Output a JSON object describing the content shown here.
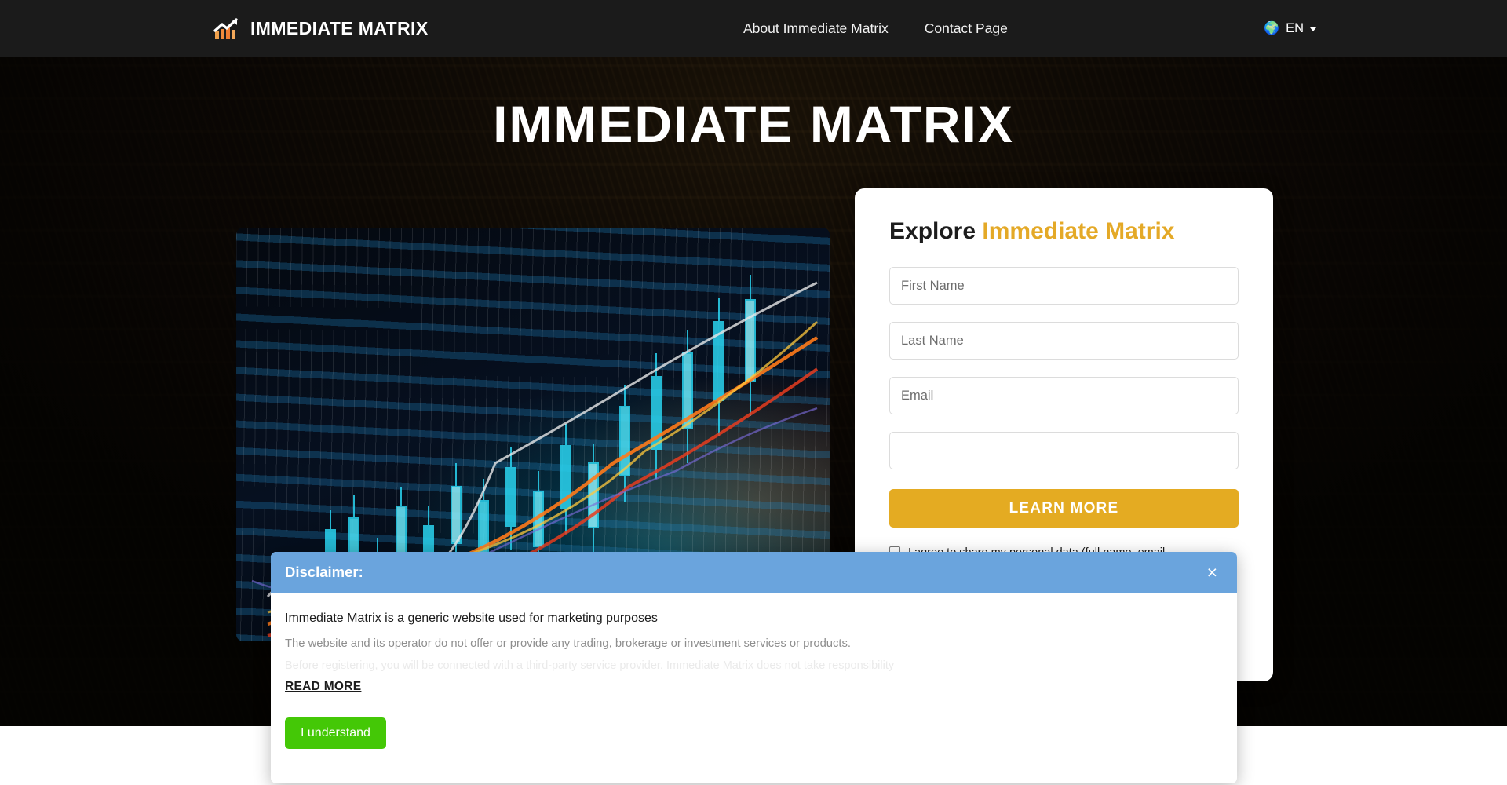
{
  "navbar": {
    "brand_name": "IMMEDIATE MATRIX",
    "brand_icon": "chart-growth-icon",
    "links": [
      {
        "label": "About Immediate Matrix"
      },
      {
        "label": "Contact Page"
      }
    ],
    "language": {
      "icon": "globe-icon",
      "glyph": "🌍",
      "code": "EN",
      "caret": "chevron-down-icon"
    }
  },
  "hero": {
    "title": "IMMEDIATE MATRIX",
    "image_alt": "trading-chart-image"
  },
  "form": {
    "heading_main": "Explore",
    "heading_accent": "Immediate Matrix",
    "fields": [
      {
        "name": "first-name",
        "placeholder": "First Name",
        "value": ""
      },
      {
        "name": "last-name",
        "placeholder": "Last Name",
        "value": ""
      },
      {
        "name": "email",
        "placeholder": "Email",
        "value": ""
      },
      {
        "name": "phone",
        "placeholder": "",
        "value": ""
      }
    ],
    "submit_label": "LEARN MORE",
    "consent_text": "I agree to share my personal data (full name, email",
    "consent_checked": false
  },
  "modal": {
    "title": "Disclaimer:",
    "close_icon": "close-icon",
    "close_glyph": "×",
    "paragraph_1": "Immediate Matrix is a generic website used for marketing purposes",
    "paragraph_2": "The website and its operator do not offer or provide any trading, brokerage or investment services or products.",
    "paragraph_3": "Before registering, you will be connected with a third-party service provider. Immediate Matrix does not take responsibility",
    "read_more_label": "READ MORE",
    "confirm_label": "I understand"
  },
  "colors": {
    "navbar_bg": "#1b1b1b",
    "hero_bg": "#140e07",
    "accent_gold": "#e4a927",
    "button_gold": "#e4ab22",
    "modal_header_blue": "#6aa4dd",
    "confirm_green": "#44c806",
    "card_white": "#ffffff"
  }
}
